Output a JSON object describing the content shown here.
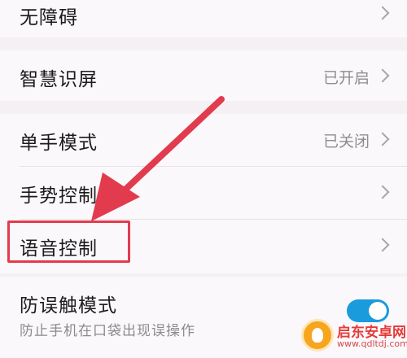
{
  "settings": {
    "accessibility": {
      "label": "无障碍"
    },
    "smart_screen": {
      "label": "智慧识屏",
      "value": "已开启"
    },
    "one_hand_mode": {
      "label": "单手模式",
      "value": "已关闭"
    },
    "gesture_control": {
      "label": "手势控制"
    },
    "voice_control": {
      "label": "语音控制"
    },
    "accidental_touch": {
      "label": "防误触模式",
      "description": "防止手机在口袋出现误操作",
      "enabled": true
    }
  },
  "annotation": {
    "arrow_color": "#e23b4e",
    "highlight_color": "#e23b4e"
  },
  "watermark": {
    "name": "启东安卓网",
    "url": "www.qdltdj.com"
  },
  "colors": {
    "accent": "#1a9bdc",
    "background": "#f4f0f4",
    "card": "#fbf8fb"
  }
}
